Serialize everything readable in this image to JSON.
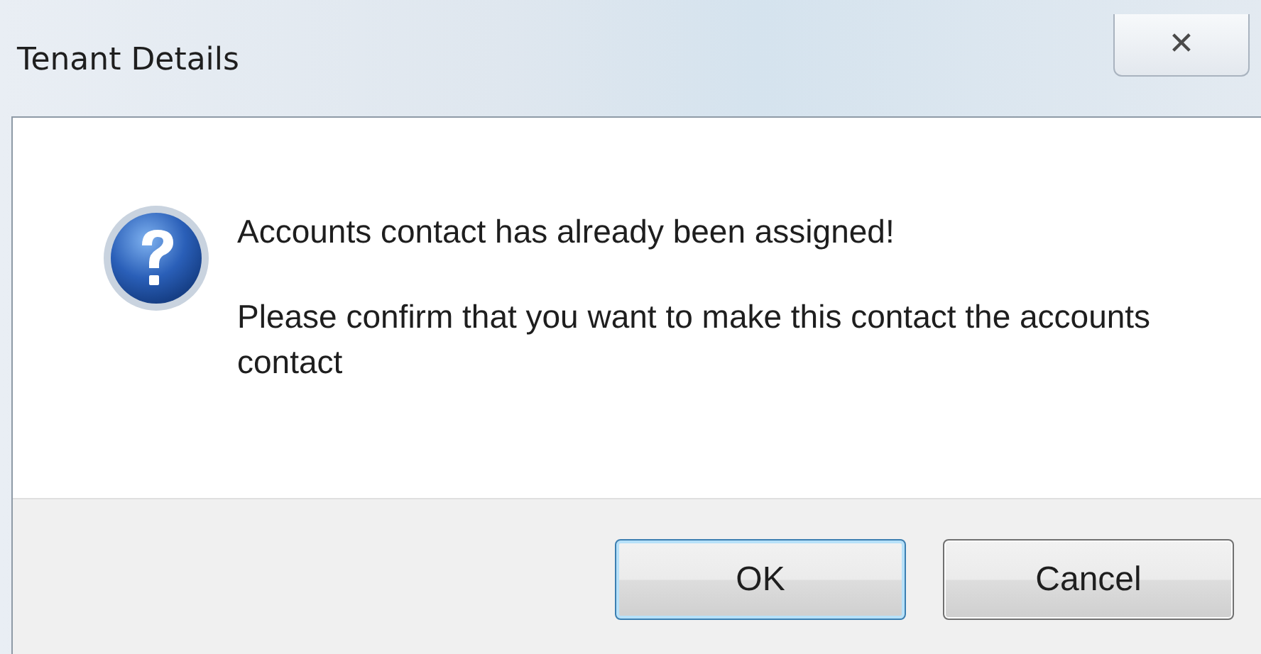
{
  "window": {
    "title": "Tenant Details",
    "close": "✕"
  },
  "message": {
    "heading": "Accounts contact has already been assigned!",
    "body": "Please confirm that you want to make this contact the accounts contact"
  },
  "buttons": [
    {
      "label": "OK",
      "selected": true
    },
    {
      "label": "Cancel",
      "selected": false
    }
  ]
}
